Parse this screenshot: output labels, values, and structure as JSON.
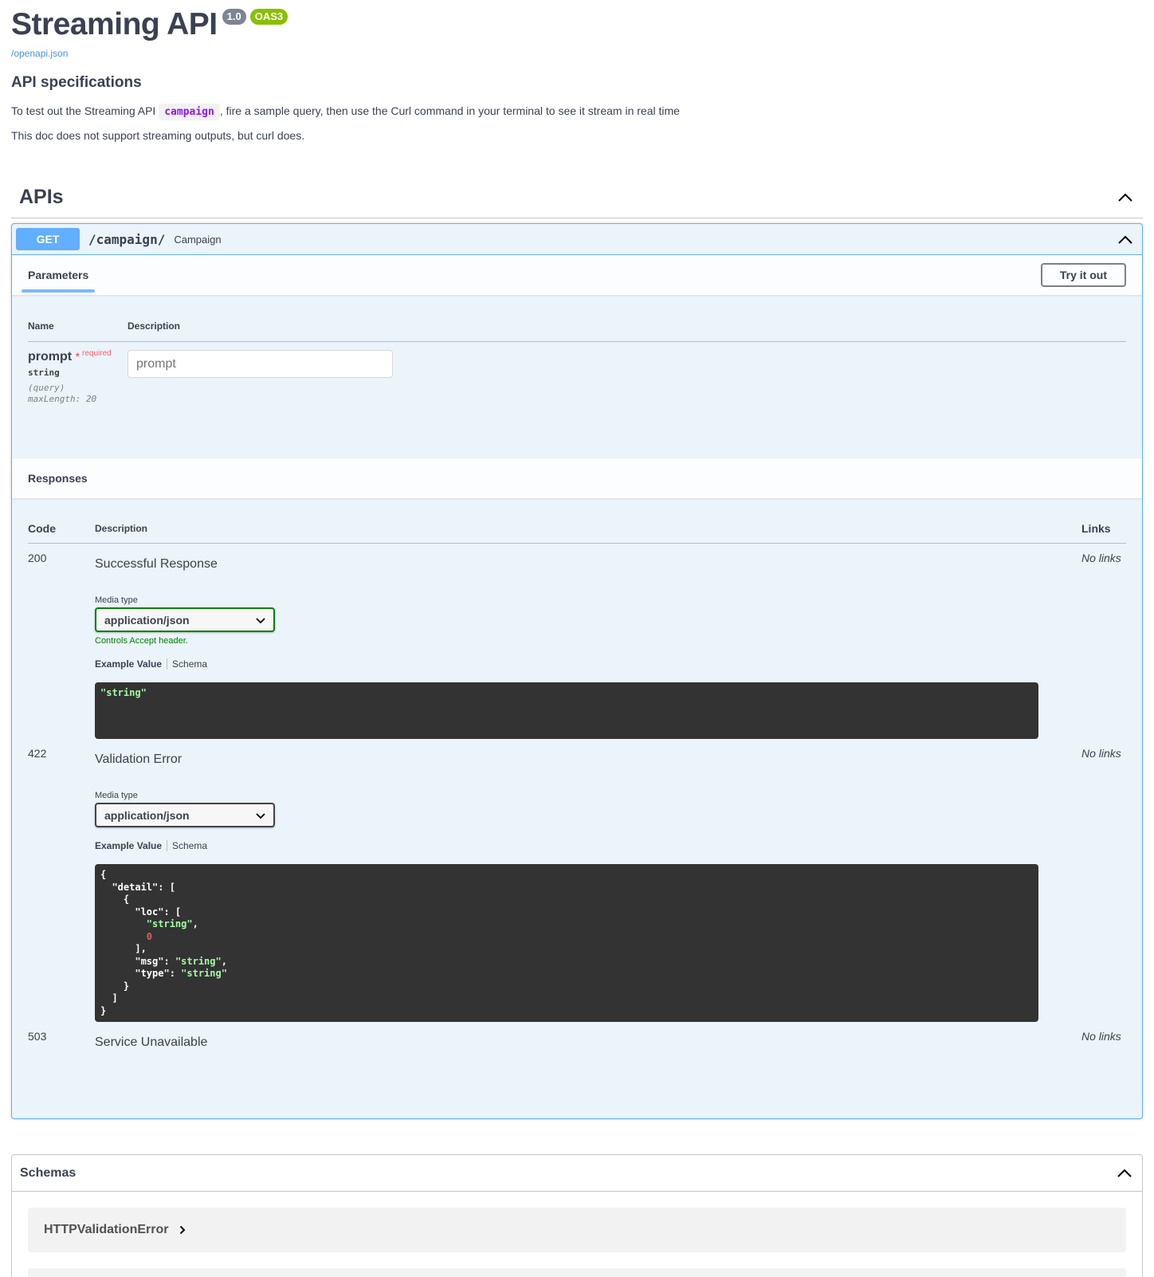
{
  "info": {
    "title": "Streaming API",
    "version": "1.0",
    "oas": "OAS3",
    "spec_link": "/openapi.json",
    "heading": "API specifications",
    "desc1_pre": "To test out the Streaming API ",
    "desc1_code": "campaign",
    "desc1_post": ", fire a sample query, then use the Curl command in your terminal to see it stream in real time",
    "desc2": "This doc does not support streaming outputs, but curl does."
  },
  "section": {
    "title": "APIs"
  },
  "operation": {
    "method": "GET",
    "path": "/campaign/",
    "summary": "Campaign",
    "tab_parameters": "Parameters",
    "try_label": "Try it out",
    "col_name": "Name",
    "col_description": "Description",
    "param": {
      "name": "prompt",
      "star": "*",
      "required": "required",
      "type": "string",
      "in": "(query)",
      "constraint": "maxLength: 20",
      "placeholder": "prompt"
    },
    "responses_title": "Responses",
    "resp_cols": {
      "code": "Code",
      "description": "Description",
      "links": "Links"
    },
    "responses": [
      {
        "code": "200",
        "description": "Successful Response",
        "links": "No links",
        "media_label": "Media type",
        "media_value": "application/json",
        "controls_pre": "Controls ",
        "controls_code": "Accept",
        "controls_post": " header.",
        "example_tab": "Example Value",
        "schema_tab": "Schema",
        "example": "\"string\""
      },
      {
        "code": "422",
        "description": "Validation Error",
        "links": "No links",
        "media_label": "Media type",
        "media_value": "application/json",
        "example_tab": "Example Value",
        "schema_tab": "Schema",
        "example_lines": {
          "l1": "{",
          "l2_key": "  \"detail\"",
          "l2_rest": ": [",
          "l3": "    {",
          "l4_key": "      \"loc\"",
          "l4_rest": ": [",
          "l5_str": "        \"string\"",
          "l5_rest": ",",
          "l6_num": "        0",
          "l7": "      ],",
          "l8_key": "      \"msg\"",
          "l8_colon": ": ",
          "l8_str": "\"string\"",
          "l8_rest": ",",
          "l9_key": "      \"type\"",
          "l9_colon": ": ",
          "l9_str": "\"string\"",
          "l10": "    }",
          "l11": "  ]",
          "l12": "}"
        }
      },
      {
        "code": "503",
        "description": "Service Unavailable",
        "links": "No links"
      }
    ]
  },
  "schemas": {
    "title": "Schemas",
    "models": [
      "HTTPValidationError"
    ]
  },
  "colors": {
    "get_accent": "#61affe",
    "text": "#3b4151",
    "link": "#4990e2",
    "badge_version": "#7d8492",
    "badge_oas": "#89bf04",
    "code_bg": "#333333",
    "string_green": "#a2fca2",
    "number_red": "#d36363",
    "accept_green": "#008000"
  },
  "icons": {
    "collapse": "chevron-up-icon",
    "select": "chevron-down-icon",
    "model_expand": "chevron-right-icon"
  }
}
